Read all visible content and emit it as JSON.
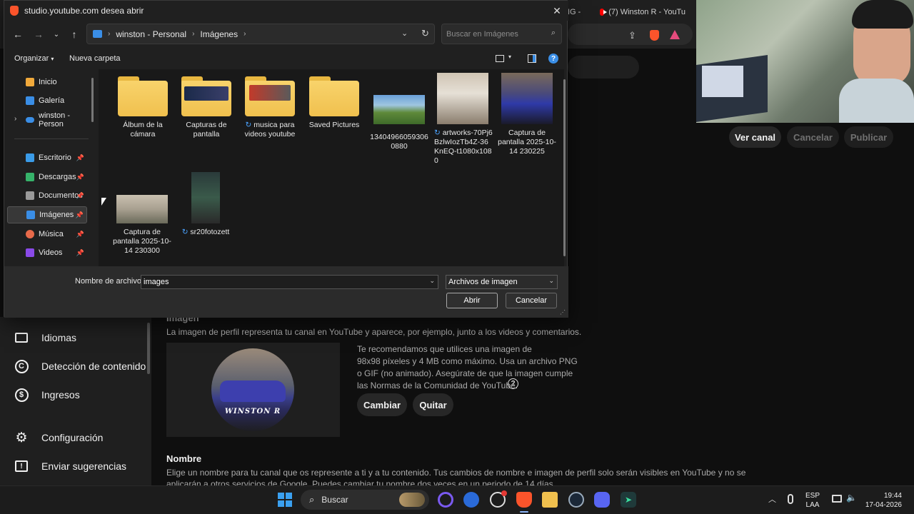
{
  "browser": {
    "tab_partial": "NG -",
    "tab_youtube": "(7) Winston R - YouTu"
  },
  "studio": {
    "buttons": {
      "view_channel": "Ver canal",
      "cancel": "Cancelar",
      "publish": "Publicar"
    },
    "sidebar": {
      "items": [
        {
          "label": "Idiomas",
          "icon": "languages-icon"
        },
        {
          "label": "Detección de contenido",
          "icon": "copyright-icon"
        },
        {
          "label": "Ingresos",
          "icon": "dollar-icon"
        },
        {
          "label": "Configuración",
          "icon": "gear-icon"
        },
        {
          "label": "Enviar sugerencias",
          "icon": "feedback-icon"
        }
      ]
    },
    "image_section": {
      "title": "Imagen",
      "description": "La imagen de perfil representa tu canal en YouTube y aparece, por ejemplo, junto a los videos y comentarios.",
      "avatar_text": "WINSTON R",
      "recommendation_lines": [
        "Te recomendamos que utilices una imagen de",
        "98x98 píxeles y 4 MB como máximo. Usa un archivo PNG",
        "o GIF (no animado). Asegúrate de que la imagen cumple",
        "las Normas de la Comunidad de YouTube."
      ],
      "change_label": "Cambiar",
      "remove_label": "Quitar"
    },
    "name_section": {
      "title": "Nombre",
      "line1": "Elige un nombre para tu canal que os represente a ti y a tu contenido. Tus cambios de nombre e imagen de perfil solo serán visibles en YouTube y no se",
      "line2": "aplicarán a otros servicios de Google. Puedes cambiar tu nombre dos veces en un periodo de 14 días."
    }
  },
  "dialog": {
    "title": "studio.youtube.com desea abrir",
    "breadcrumb": [
      "winston - Personal",
      "Imágenes"
    ],
    "search_placeholder": "Buscar en Imágenes",
    "commands": {
      "organize": "Organizar",
      "new_folder": "Nueva carpeta"
    },
    "nav": [
      {
        "label": "Inicio",
        "color": "#f0a93b",
        "pinned": false
      },
      {
        "label": "Galería",
        "color": "#3a8ee6",
        "pinned": false
      },
      {
        "label": "winston - Person",
        "color": "#3a8ee6",
        "pinned": false
      },
      {
        "label": "Escritorio",
        "color": "#3a9be8",
        "pinned": true
      },
      {
        "label": "Descargas",
        "color": "#36b36a",
        "pinned": true
      },
      {
        "label": "Documentos",
        "color": "#9a9a9a",
        "pinned": true
      },
      {
        "label": "Imágenes",
        "color": "#3a8ee6",
        "pinned": true
      },
      {
        "label": "Música",
        "color": "#e86a4a",
        "pinned": true
      },
      {
        "label": "Videos",
        "color": "#8a4ae8",
        "pinned": true
      }
    ],
    "files": [
      {
        "name": "Álbum de la cámara",
        "kind": "folder"
      },
      {
        "name": "Capturas de pantalla",
        "kind": "folder"
      },
      {
        "name": "musica para videos youtube",
        "kind": "folder",
        "synced": true
      },
      {
        "name": "Saved Pictures",
        "kind": "folder"
      },
      {
        "name": "134049660593060880",
        "kind": "image"
      },
      {
        "name": "artworks-70Pj6BzlwIozTb4Z-36KnEQ-t1080x1080",
        "kind": "image",
        "synced": true
      },
      {
        "name": "Captura de pantalla 2025-10-14 230225",
        "kind": "image"
      },
      {
        "name": "Captura de pantalla 2025-10-14 230300",
        "kind": "image"
      },
      {
        "name": "sr20fotozett",
        "kind": "image",
        "synced": true
      }
    ],
    "file_name_label": "Nombre de archivo:",
    "file_name_value": "images",
    "file_type": "Archivos de imagen",
    "open_label": "Abrir",
    "cancel_label": "Cancelar"
  },
  "taskbar": {
    "search_label": "Buscar",
    "lang_top": "ESP",
    "lang_bottom": "LAA",
    "time": "19:44",
    "date": "17-04-2026"
  }
}
